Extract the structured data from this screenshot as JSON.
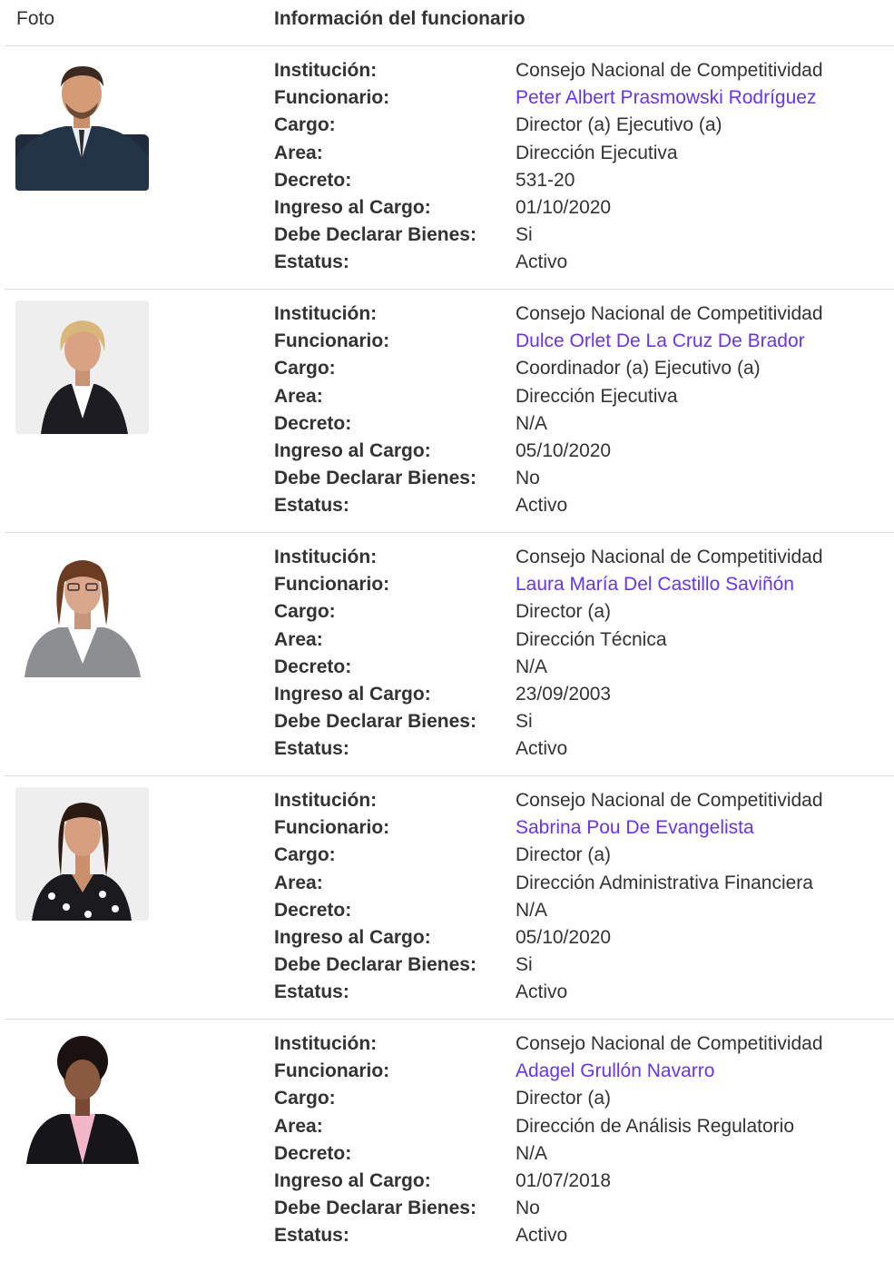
{
  "header": {
    "photo_label": "Foto",
    "info_label": "Información del funcionario"
  },
  "labels": {
    "institucion": "Institución:",
    "funcionario": "Funcionario:",
    "cargo": "Cargo:",
    "area": "Area:",
    "decreto": "Decreto:",
    "ingreso": "Ingreso al Cargo:",
    "declarar": "Debe Declarar Bienes:",
    "estatus": "Estatus:"
  },
  "rows": [
    {
      "institucion": "Consejo Nacional de Competitividad",
      "funcionario": "Peter Albert Prasmowski Rodríguez",
      "cargo": "Director (a) Ejecutivo (a)",
      "area": "Dirección Ejecutiva",
      "decreto": "531-20",
      "ingreso": "01/10/2020",
      "declarar": "Si",
      "estatus": "Activo"
    },
    {
      "institucion": "Consejo Nacional de Competitividad",
      "funcionario": "Dulce Orlet De La Cruz De Brador",
      "cargo": "Coordinador (a) Ejecutivo (a)",
      "area": "Dirección Ejecutiva",
      "decreto": "N/A",
      "ingreso": "05/10/2020",
      "declarar": "No",
      "estatus": "Activo"
    },
    {
      "institucion": "Consejo Nacional de Competitividad",
      "funcionario": "Laura María Del Castillo Saviñón",
      "cargo": "Director (a)",
      "area": "Dirección Técnica",
      "decreto": "N/A",
      "ingreso": "23/09/2003",
      "declarar": "Si",
      "estatus": "Activo"
    },
    {
      "institucion": "Consejo Nacional de Competitividad",
      "funcionario": "Sabrina Pou De Evangelista",
      "cargo": "Director (a)",
      "area": "Dirección Administrativa Financiera",
      "decreto": "N/A",
      "ingreso": "05/10/2020",
      "declarar": "Si",
      "estatus": "Activo"
    },
    {
      "institucion": "Consejo Nacional de Competitividad",
      "funcionario": "Adagel Grullón Navarro",
      "cargo": "Director (a)",
      "area": "Dirección de Análisis Regulatorio",
      "decreto": "N/A",
      "ingreso": "01/07/2018",
      "declarar": "No",
      "estatus": "Activo"
    }
  ],
  "colors": {
    "link": "#6633ff",
    "text": "#333333",
    "divider": "#dddddd"
  }
}
